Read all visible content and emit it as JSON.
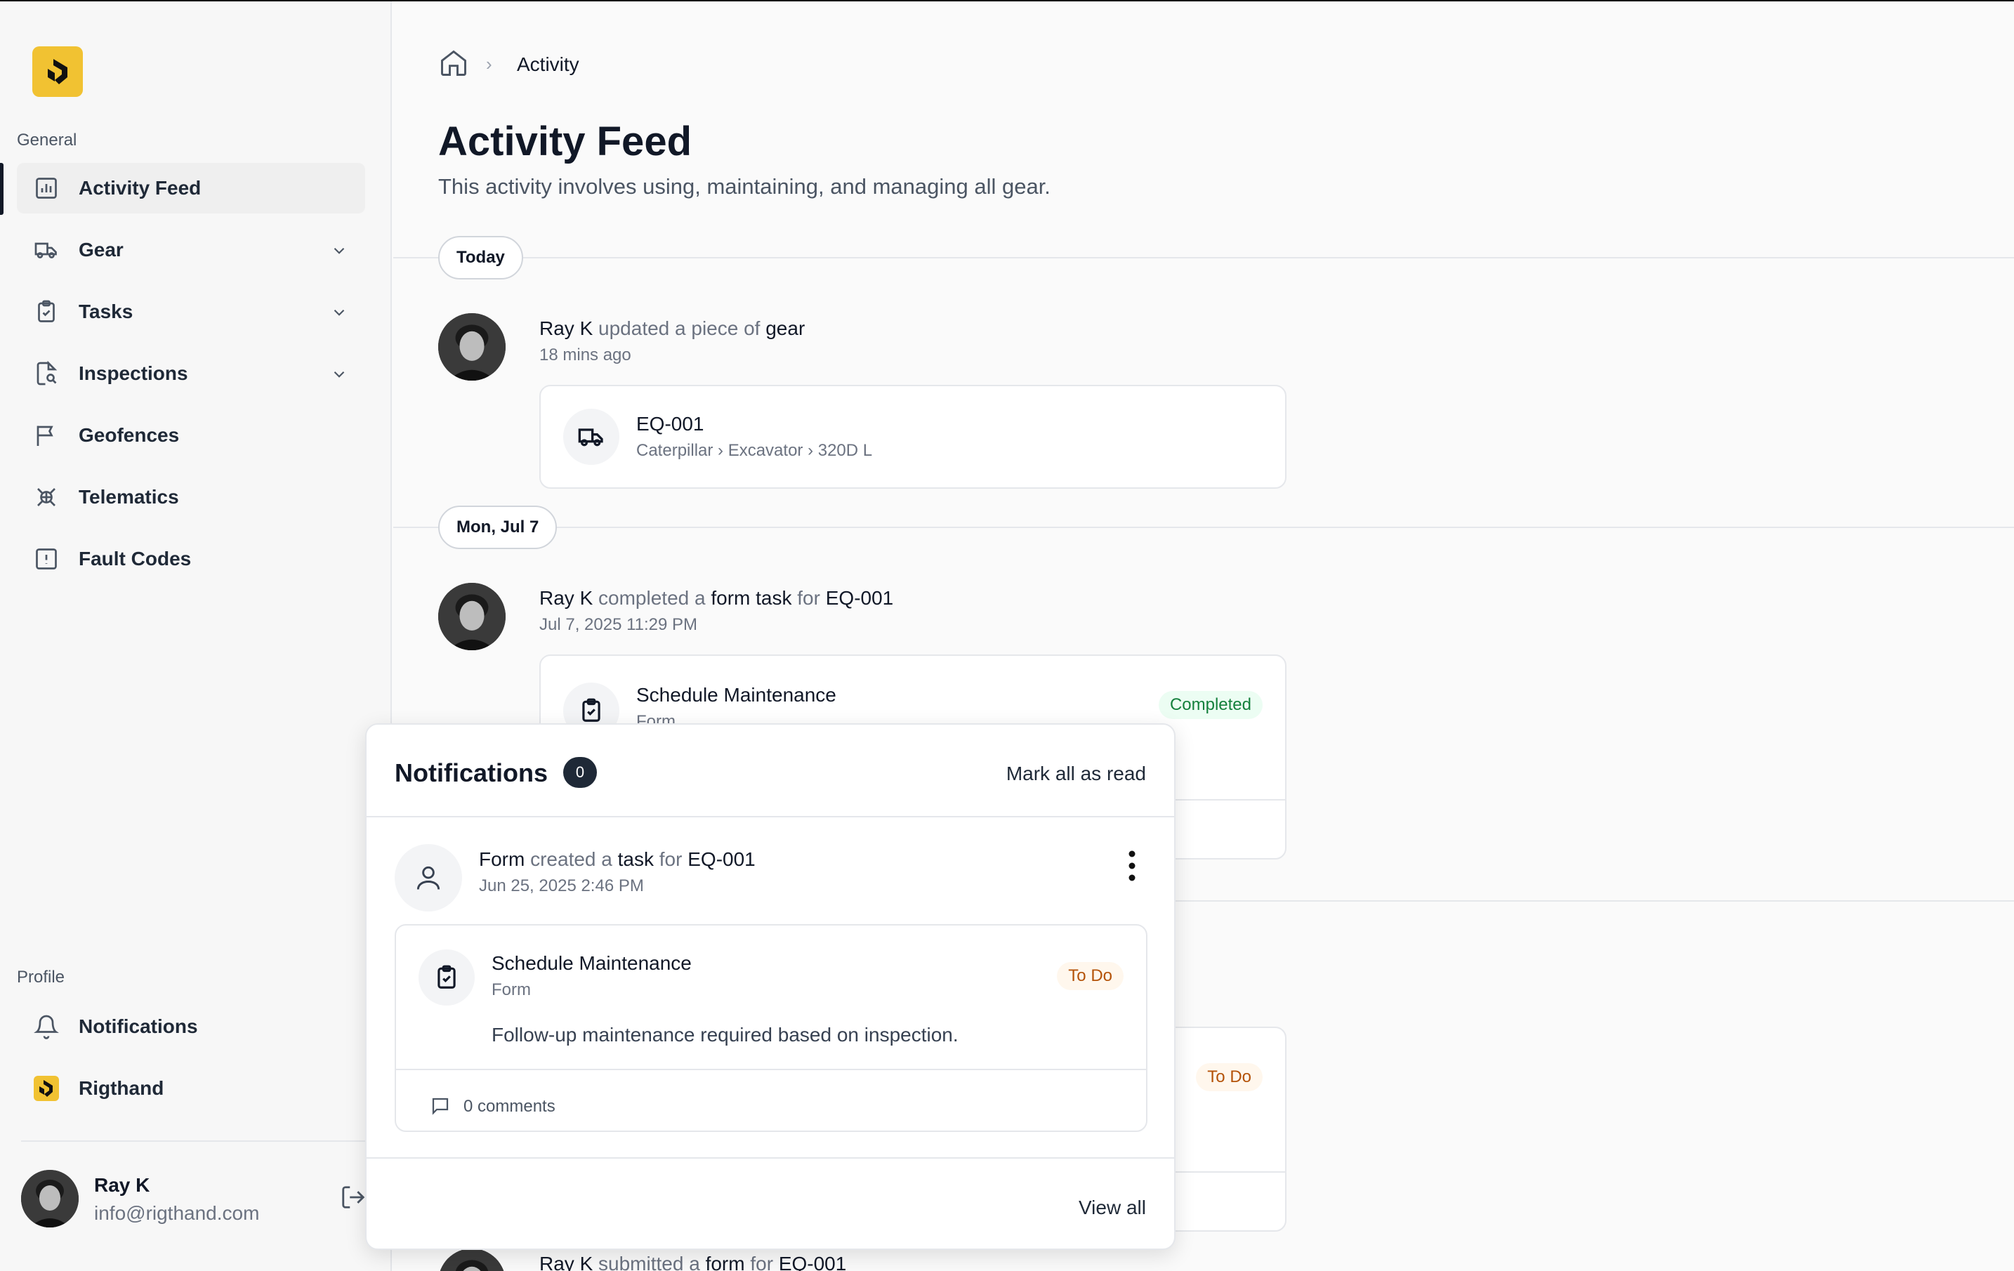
{
  "sidebar": {
    "general_label": "General",
    "items": [
      {
        "label": "Activity Feed",
        "icon": "bar-chart-icon",
        "active": true
      },
      {
        "label": "Gear",
        "icon": "truck-icon"
      },
      {
        "label": "Tasks",
        "icon": "clipboard-check-icon"
      },
      {
        "label": "Inspections",
        "icon": "file-search-icon"
      },
      {
        "label": "Geofences",
        "icon": "flag-icon"
      },
      {
        "label": "Telematics",
        "icon": "satellite-icon"
      },
      {
        "label": "Fault Codes",
        "icon": "alert-square-icon"
      }
    ],
    "profile_label": "Profile",
    "profile_items": [
      {
        "label": "Notifications",
        "icon": "bell-icon"
      },
      {
        "label": "Rigthand",
        "icon": "rigthand-logo-icon"
      }
    ],
    "user": {
      "name": "Ray K",
      "email": "info@rigthand.com"
    }
  },
  "breadcrumb": {
    "separator": "›",
    "current": "Activity"
  },
  "page": {
    "title": "Activity Feed",
    "subtitle": "This activity involves using, maintaining, and managing all gear."
  },
  "feed": {
    "groups": [
      {
        "date": "Today",
        "activity": {
          "actor": "Ray K",
          "verb": "updated a piece of",
          "object": "gear",
          "time": "18 mins ago",
          "card": {
            "title": "EQ-001",
            "subtitle": "Caterpillar › Excavator › 320D L"
          }
        }
      },
      {
        "date": "Mon, Jul 7",
        "activity": {
          "actor": "Ray K",
          "verb": "completed a",
          "object": "form task",
          "prep": "for",
          "target": "EQ-001",
          "time": "Jul 7, 2025 11:29 PM",
          "card": {
            "title": "Schedule Maintenance",
            "subtitle": "Form",
            "status": "Completed"
          }
        }
      }
    ],
    "hidden_card_status": "To Do",
    "bottom_activity": {
      "actor": "Ray K",
      "verb": "submitted a",
      "object": "form",
      "prep": "for",
      "target": "EQ-001"
    }
  },
  "notifications": {
    "title": "Notifications",
    "count": "0",
    "mark_all_label": "Mark all as read",
    "item": {
      "actor": "Form",
      "verb": "created a",
      "object": "task",
      "prep": "for",
      "target": "EQ-001",
      "time": "Jun 25, 2025 2:46 PM",
      "card": {
        "title": "Schedule Maintenance",
        "subtitle": "Form",
        "status": "To Do",
        "description": "Follow-up maintenance required based on inspection.",
        "comments": "0 comments"
      }
    },
    "view_all_label": "View all"
  },
  "colors": {
    "brand": "#f1c232",
    "completed": "#15803d",
    "todo": "#b45309"
  }
}
